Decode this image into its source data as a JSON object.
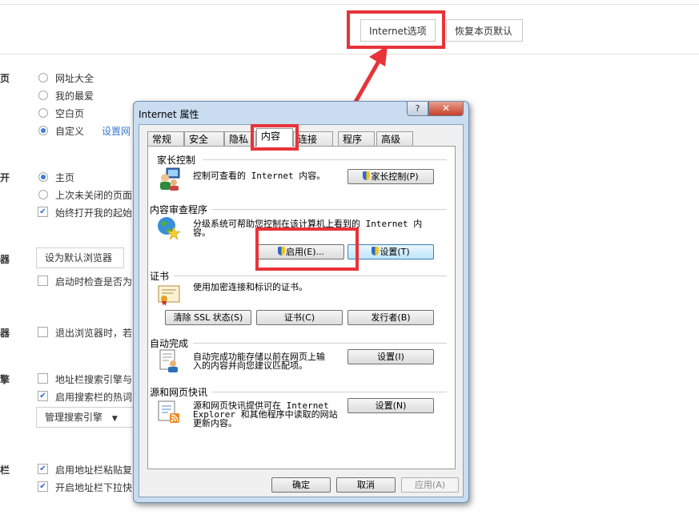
{
  "top_bar": {
    "internet_options_label": "Internet选项",
    "restore_defaults_label": "恢复本页默认"
  },
  "settings": {
    "homepage": {
      "section": "页",
      "options": [
        "网址大全",
        "我的最爱",
        "空白页",
        "自定义"
      ],
      "selected": "自定义",
      "link": "设置网"
    },
    "startup": {
      "section": "开",
      "options": [
        "主页",
        "上次未关闭的页面"
      ],
      "selected": "主页",
      "checkbox": "始终打开我的起始"
    },
    "default_browser": {
      "section": "器",
      "button": "设为默认浏览器",
      "checkbox": "启动时检查是否为"
    },
    "exit": {
      "section": "器",
      "checkbox": "退出浏览器时，若"
    },
    "search": {
      "section": "擎",
      "checkbox1": "地址栏搜索引擎与",
      "checkbox2": "启用搜索栏的热词",
      "dropdown": "管理搜索引擎"
    },
    "address_bar": {
      "section": "栏",
      "checkbox1": "启用地址栏粘贴复",
      "checkbox2": "开启地址栏下拉快"
    }
  },
  "dialog": {
    "title": "Internet 属性",
    "help": "?",
    "close": "✕",
    "tabs": [
      "常规",
      "安全",
      "隐私",
      "内容",
      "连接",
      "程序",
      "高级"
    ],
    "active_tab": "内容",
    "parental": {
      "heading": "家长控制",
      "text": "控制可查看的 Internet 内容。",
      "button": "家长控制(P)"
    },
    "advisor": {
      "heading": "内容审查程序",
      "text_line1": "分级系统可帮助您控制在该计算机上看到的 Internet 内",
      "text_line2": "容。",
      "enable_button": "启用(E)...",
      "settings_button": "设置(T)"
    },
    "certificates": {
      "heading": "证书",
      "text": "使用加密连接和标识的证书。",
      "clear_ssl": "清除 SSL 状态(S)",
      "certs": "证书(C)",
      "publishers": "发行者(B)"
    },
    "autocomplete": {
      "heading": "自动完成",
      "text_line1": "自动完成功能存储以前在网页上输",
      "text_line2": "入的内容并向您建议匹配项。",
      "button": "设置(I)"
    },
    "feeds": {
      "heading": "源和网页快讯",
      "text_line1": "源和网页快讯提供可在 Internet",
      "text_line2": "Explorer 和其他程序中读取的网站",
      "text_line3": "更新内容。",
      "button": "设置(N)"
    },
    "footer": {
      "ok": "确定",
      "cancel": "取消",
      "apply": "应用(A)"
    }
  },
  "colors": {
    "highlight": "#e8333a",
    "accent": "#3a7bd5"
  }
}
